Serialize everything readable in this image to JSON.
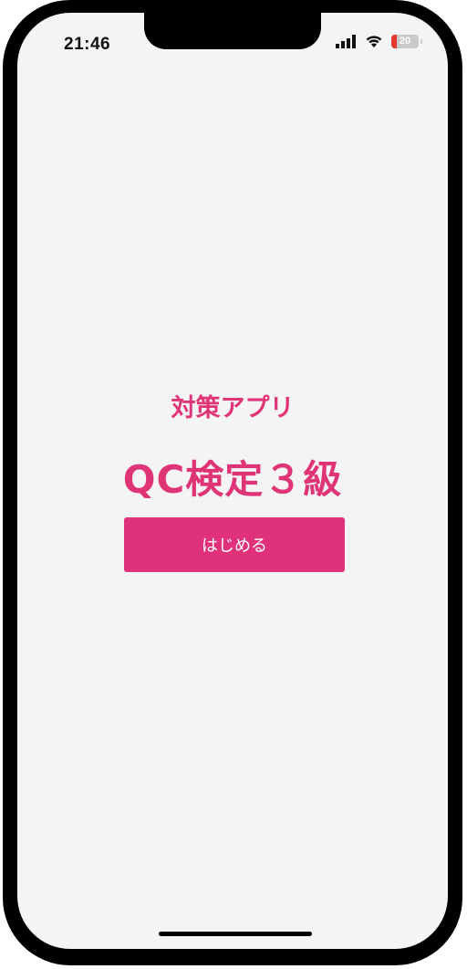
{
  "status_bar": {
    "time": "21:46",
    "battery_percent": "20",
    "battery_level": 0.2,
    "battery_color": "#e8372f",
    "icons": [
      "signal-icon",
      "wifi-icon",
      "battery-icon"
    ]
  },
  "main": {
    "subtitle": "対策アプリ",
    "title": "QC検定３級",
    "start_button_label": "はじめる"
  },
  "colors": {
    "accent": "#df3576",
    "button": "#e0327a",
    "background": "#f4f4f4"
  }
}
